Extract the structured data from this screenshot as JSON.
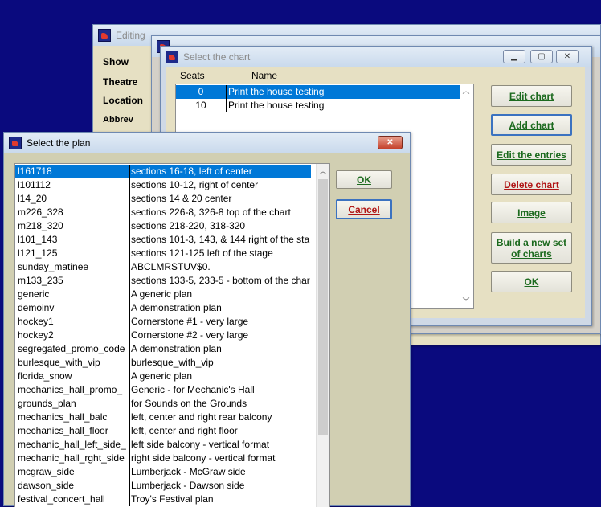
{
  "editing_window": {
    "title": "Editing",
    "sidebar": [
      "Show",
      "Theatre",
      "Location",
      "Abbrev"
    ]
  },
  "chart_dialog": {
    "title": "Select the chart",
    "columns": {
      "seats": "Seats",
      "name": "Name"
    },
    "rows": [
      {
        "seats": "0",
        "name": "Print the house testing"
      },
      {
        "seats": "10",
        "name": "Print the house testing"
      }
    ],
    "buttons": {
      "edit_chart": "Edit chart",
      "add_chart": "Add chart",
      "edit_entries": "Edit the entries",
      "delete_chart": "Delete chart",
      "image": "Image",
      "build_new_set": "Build a new set of charts",
      "ok": "OK"
    }
  },
  "plan_dialog": {
    "title": "Select the plan",
    "buttons": {
      "ok": "OK",
      "cancel": "Cancel"
    },
    "rows": [
      {
        "code": "l161718",
        "desc": "sections 16-18, left of center"
      },
      {
        "code": "l101112",
        "desc": "sections 10-12, right of center"
      },
      {
        "code": "l14_20",
        "desc": "sections 14 & 20 center"
      },
      {
        "code": "m226_328",
        "desc": "sections 226-8, 326-8 top of the chart"
      },
      {
        "code": "m218_320",
        "desc": "sections 218-220, 318-320"
      },
      {
        "code": "l101_143",
        "desc": "sections 101-3, 143, & 144 right of the sta"
      },
      {
        "code": "l121_125",
        "desc": "sections 121-125 left of the stage"
      },
      {
        "code": "sunday_matinee",
        "desc": "ABCLMRSTUV$0."
      },
      {
        "code": "m133_235",
        "desc": "sections 133-5, 233-5 - bottom of the char"
      },
      {
        "code": "generic",
        "desc": "A generic plan"
      },
      {
        "code": "demoinv",
        "desc": "A demonstration plan"
      },
      {
        "code": "hockey1",
        "desc": "Cornerstone #1 - very large"
      },
      {
        "code": "hockey2",
        "desc": "Cornerstone #2 - very large"
      },
      {
        "code": "segregated_promo_code",
        "desc": "A demonstration plan"
      },
      {
        "code": "burlesque_with_vip",
        "desc": "burlesque_with_vip"
      },
      {
        "code": "florida_snow",
        "desc": "A generic plan"
      },
      {
        "code": "mechanics_hall_promo_",
        "desc": "Generic - for Mechanic's Hall"
      },
      {
        "code": "grounds_plan",
        "desc": "for Sounds on the Grounds"
      },
      {
        "code": "mechanics_hall_balc",
        "desc": "left, center and right rear balcony"
      },
      {
        "code": "mechanics_hall_floor",
        "desc": "left, center and right floor"
      },
      {
        "code": "mechanic_hall_left_side_",
        "desc": "left side balcony - vertical format"
      },
      {
        "code": "mechanic_hall_rght_side",
        "desc": "right side balcony - vertical format"
      },
      {
        "code": "mcgraw_side",
        "desc": "Lumberjack - McGraw side"
      },
      {
        "code": "dawson_side",
        "desc": "Lumberjack - Dawson side"
      },
      {
        "code": "festival_concert_hall",
        "desc": "Troy's Festival plan"
      }
    ]
  },
  "colors": {
    "desktop": "#0a0a7e",
    "selection": "#0078d7",
    "panel": "#e6e0c3",
    "button_green": "#1c6a1e",
    "button_red": "#b01515"
  }
}
